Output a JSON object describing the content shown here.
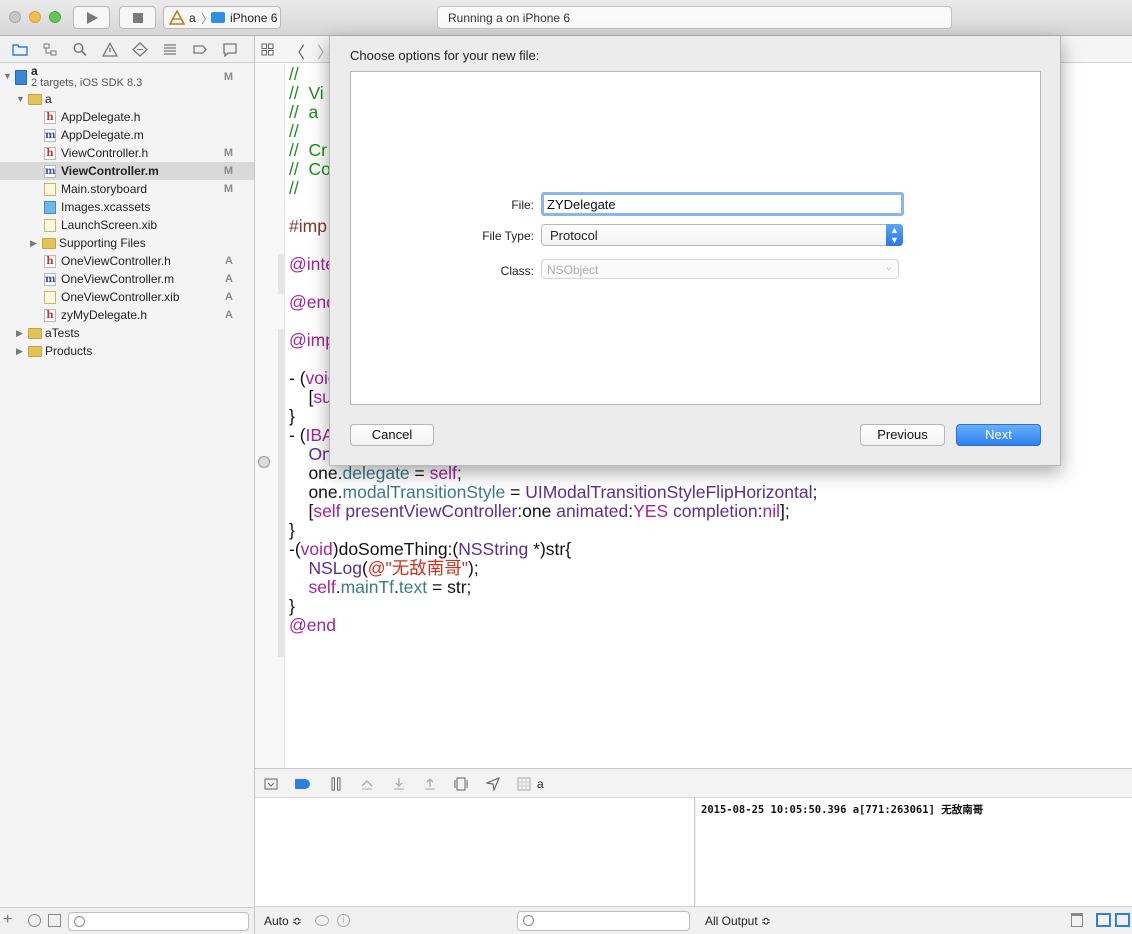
{
  "toolbar": {
    "scheme_name": "a",
    "device": "iPhone 6",
    "activity_status": "Running a on iPhone 6"
  },
  "navigator": {
    "project": {
      "name": "a",
      "subtitle": "2 targets, iOS SDK 8.3",
      "badge": "M"
    },
    "items": [
      {
        "label": "a",
        "type": "folder",
        "indent": 1,
        "expanded": true,
        "badge": ""
      },
      {
        "label": "AppDelegate.h",
        "type": "h",
        "indent": 2,
        "badge": ""
      },
      {
        "label": "AppDelegate.m",
        "type": "m",
        "indent": 2,
        "badge": ""
      },
      {
        "label": "ViewController.h",
        "type": "h",
        "indent": 2,
        "badge": "M"
      },
      {
        "label": "ViewController.m",
        "type": "m",
        "indent": 2,
        "badge": "M",
        "selected": true
      },
      {
        "label": "Main.storyboard",
        "type": "storyboard",
        "indent": 2,
        "badge": "M"
      },
      {
        "label": "Images.xcassets",
        "type": "assets",
        "indent": 2,
        "badge": ""
      },
      {
        "label": "LaunchScreen.xib",
        "type": "xib",
        "indent": 2,
        "badge": ""
      },
      {
        "label": "Supporting Files",
        "type": "folder",
        "indent": 2,
        "expanded": false,
        "badge": ""
      },
      {
        "label": "OneViewController.h",
        "type": "h",
        "indent": 2,
        "badge": "A"
      },
      {
        "label": "OneViewController.m",
        "type": "m",
        "indent": 2,
        "badge": "A"
      },
      {
        "label": "OneViewController.xib",
        "type": "xib",
        "indent": 2,
        "badge": "A"
      },
      {
        "label": "zyMyDelegate.h",
        "type": "h",
        "indent": 2,
        "badge": "A"
      },
      {
        "label": "aTests",
        "type": "folder",
        "indent": 1,
        "expanded": false,
        "badge": ""
      },
      {
        "label": "Products",
        "type": "folder",
        "indent": 1,
        "expanded": false,
        "badge": ""
      }
    ]
  },
  "editor": {
    "lines": [
      [
        {
          "t": "//",
          "c": "com"
        }
      ],
      [
        {
          "t": "//  Vi",
          "c": "com"
        }
      ],
      [
        {
          "t": "//  a",
          "c": "com"
        }
      ],
      [
        {
          "t": "//",
          "c": "com"
        }
      ],
      [
        {
          "t": "//  Cr",
          "c": "com"
        }
      ],
      [
        {
          "t": "//  Co",
          "c": "com"
        }
      ],
      [
        {
          "t": "//",
          "c": "com"
        }
      ],
      [],
      [
        {
          "t": "#imp",
          "c": "pp"
        }
      ],
      [],
      [
        {
          "t": "@inte",
          "c": "kw"
        }
      ],
      [],
      [
        {
          "t": "@end",
          "c": "kw"
        }
      ],
      [],
      [
        {
          "t": "@imp",
          "c": "kw"
        }
      ],
      [],
      [
        {
          "t": "- (",
          "c": "plain"
        },
        {
          "t": "void",
          "c": "kw"
        }
      ],
      [
        {
          "t": "    [",
          "c": "plain"
        },
        {
          "t": "su",
          "c": "kw"
        }
      ],
      [
        {
          "t": "}",
          "c": "plain"
        }
      ],
      [
        {
          "t": "- (",
          "c": "plain"
        },
        {
          "t": "IBA",
          "c": "kw"
        }
      ],
      [
        {
          "t": "    ",
          "c": "plain"
        },
        {
          "t": "On",
          "c": "cls"
        }
      ],
      [
        {
          "t": "    one.",
          "c": "plain"
        },
        {
          "t": "delegate",
          "c": "prop"
        },
        {
          "t": " = ",
          "c": "plain"
        },
        {
          "t": "self",
          "c": "kw"
        },
        {
          "t": ";",
          "c": "plain"
        }
      ],
      [
        {
          "t": "    one.",
          "c": "plain"
        },
        {
          "t": "modalTransitionStyle",
          "c": "prop"
        },
        {
          "t": " = ",
          "c": "plain"
        },
        {
          "t": "UIModalTransitionStyleFlipHorizontal",
          "c": "cls"
        },
        {
          "t": ";",
          "c": "plain"
        }
      ],
      [
        {
          "t": "    [",
          "c": "plain"
        },
        {
          "t": "self",
          "c": "kw"
        },
        {
          "t": " ",
          "c": "plain"
        },
        {
          "t": "presentViewController",
          "c": "cls"
        },
        {
          "t": ":one ",
          "c": "plain"
        },
        {
          "t": "animated",
          "c": "cls"
        },
        {
          "t": ":",
          "c": "plain"
        },
        {
          "t": "YES",
          "c": "kw"
        },
        {
          "t": " ",
          "c": "plain"
        },
        {
          "t": "completion",
          "c": "cls"
        },
        {
          "t": ":",
          "c": "plain"
        },
        {
          "t": "nil",
          "c": "kw"
        },
        {
          "t": "];",
          "c": "plain"
        }
      ],
      [
        {
          "t": "}",
          "c": "plain"
        }
      ],
      [
        {
          "t": "-(",
          "c": "plain"
        },
        {
          "t": "void",
          "c": "kw"
        },
        {
          "t": ")doSomeThing:(",
          "c": "plain"
        },
        {
          "t": "NSString",
          "c": "cls"
        },
        {
          "t": " *)str{",
          "c": "plain"
        }
      ],
      [
        {
          "t": "    ",
          "c": "plain"
        },
        {
          "t": "NSLog",
          "c": "cls"
        },
        {
          "t": "(",
          "c": "plain"
        },
        {
          "t": "@\"无敌南哥\"",
          "c": "str"
        },
        {
          "t": ");",
          "c": "plain"
        }
      ],
      [
        {
          "t": "    ",
          "c": "plain"
        },
        {
          "t": "self",
          "c": "kw"
        },
        {
          "t": ".",
          "c": "plain"
        },
        {
          "t": "mainTf",
          "c": "prop"
        },
        {
          "t": ".",
          "c": "plain"
        },
        {
          "t": "text",
          "c": "prop"
        },
        {
          "t": " = str;",
          "c": "plain"
        }
      ],
      [
        {
          "t": "}",
          "c": "plain"
        }
      ],
      [
        {
          "t": "@end",
          "c": "kw"
        }
      ]
    ]
  },
  "debug": {
    "target_label": "a",
    "auto_label": "Auto ≎",
    "output_label": "All Output ≎",
    "console_text": "2015-08-25 10:05:50.396 a[771:263061] 无敌南哥"
  },
  "sheet": {
    "title": "Choose options for your new file:",
    "file_label": "File:",
    "file_value": "ZYDelegate",
    "file_type_label": "File Type:",
    "file_type_value": "Protocol",
    "class_label": "Class:",
    "class_placeholder": "NSObject",
    "cancel_label": "Cancel",
    "previous_label": "Previous",
    "next_label": "Next"
  },
  "colors": {
    "accent": "#2f7fdc",
    "comment": "#1d8d1b",
    "keyword": "#a5239b",
    "string": "#d12f1b"
  }
}
